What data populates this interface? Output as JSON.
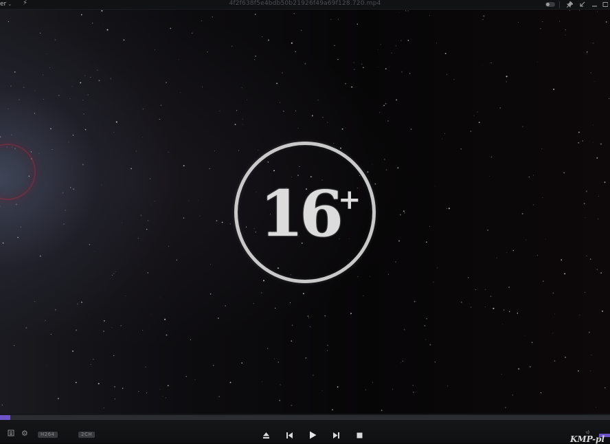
{
  "titlebar": {
    "menu_label": "er",
    "file_name": "4f2f638f5e4bdb50b21926f49a69f128.720.mp4"
  },
  "video": {
    "rating_number": "16",
    "rating_plus": "+"
  },
  "controls": {
    "seek_progress_fraction": 0.017,
    "codec_tag": "H264",
    "channel_tag": "2CH",
    "volume_indicator": "·ı)",
    "logo_text": "KMP-pl"
  },
  "colors": {
    "accent": "#6d53c8",
    "background": "#0b0b0c"
  }
}
